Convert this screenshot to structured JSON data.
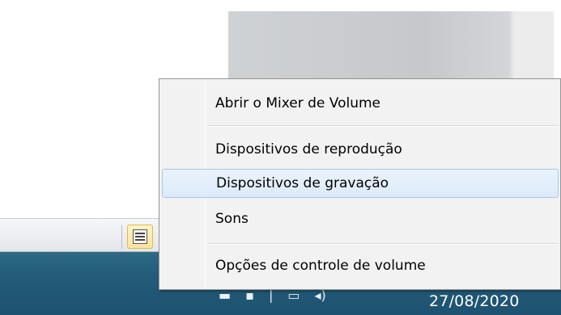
{
  "menu": {
    "items": [
      {
        "label": "Abrir o Mixer de Volume"
      },
      {
        "label": "Dispositivos de reprodução"
      },
      {
        "label": "Dispositivos de gravação"
      },
      {
        "label": "Sons"
      },
      {
        "label": "Opções de controle de volume"
      }
    ],
    "highlighted_item": "Dispositivos de gravação"
  },
  "taskbar": {
    "date": "27/08/2020",
    "tray_icons": [
      "hidden-icons-icon",
      "flag-icon",
      "pin-icon",
      "network-icon",
      "speaker-icon"
    ]
  },
  "toolbar": {
    "toggle_icon": "list-view-icon"
  },
  "colors": {
    "taskbar": "#225b78",
    "menu_background": "#f2f2f2",
    "menu_highlight": "#dceaf8",
    "toggle_highlight": "#ffe39a"
  }
}
